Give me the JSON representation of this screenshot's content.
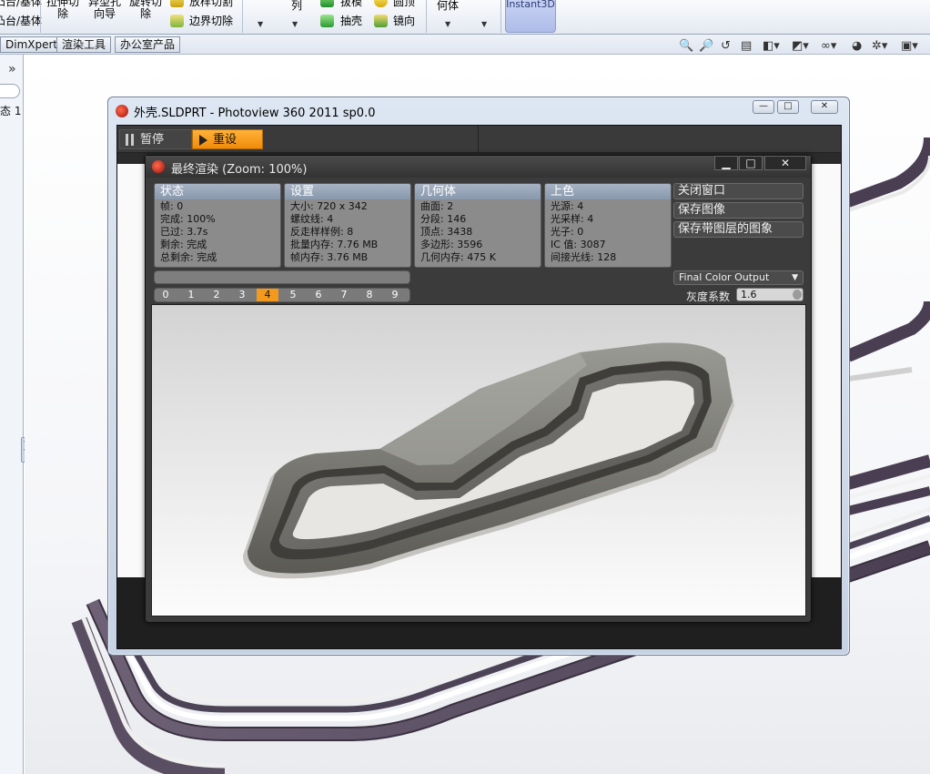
{
  "ribbon": {
    "col1": [
      "凸台/基体",
      "凸台/基体"
    ],
    "extrude_cut": "拉伸切\n除",
    "hole_wizard": "异型孔\n向导",
    "revolve_cut": "旋转切\n除",
    "sweep_cut": "放样切割",
    "boundary_cut": "边界切除",
    "pattern": "列",
    "draft": "拔模",
    "shell": "抽壳",
    "dome": "圆顶",
    "mirror": "镜向",
    "geometry": "何体",
    "instant3d": "Instant3D"
  },
  "tabs": [
    "DimXpert",
    "渲染工具",
    "办公室产品"
  ],
  "left_panel": {
    "chevron": "»",
    "state_text": "态 1"
  },
  "photoview": {
    "title": "外壳.SLDPRT - Photoview 360 2011 sp0.0",
    "pause_label": "暂停",
    "reset_label": "重设"
  },
  "final_render": {
    "title": "最终渲染 (Zoom: 100%)",
    "minimize": "▁",
    "restore": "□",
    "close": "✕",
    "status": {
      "header": "状态",
      "lines": [
        "帧: 0",
        "完成: 100%",
        "已过: 3.7s",
        "剩余: 完成",
        "总剩余: 完成"
      ]
    },
    "settings": {
      "header": "设置",
      "lines": [
        "大小: 720 x 342",
        "螺纹线: 4",
        "反走样样例: 8",
        "批量内存: 7.76 MB",
        "帧内存: 3.76 MB"
      ]
    },
    "geometry": {
      "header": "几何体",
      "lines": [
        "曲面: 2",
        "分段: 146",
        "顶点: 3438",
        "多边形: 3596",
        "几何内存: 475 K"
      ]
    },
    "shading": {
      "header": "上色",
      "lines": [
        "光源: 4",
        "光采样: 4",
        "光子: 0",
        "IC 值: 3087",
        "间接光线: 128"
      ]
    },
    "actions": {
      "close_window": "关闭窗口",
      "save_image": "保存图像",
      "save_layers": "保存带图层的图象"
    },
    "frames": [
      "0",
      "1",
      "2",
      "3",
      "4",
      "5",
      "6",
      "7",
      "8",
      "9"
    ],
    "active_frame": "4",
    "output_select": "Final Color Output",
    "gamma_label": "灰度系数",
    "gamma_value": "1.6",
    "progress": 0
  },
  "colors": {
    "accent_orange": "#f39a1e",
    "header_blue": "#8898ad",
    "dark_panel": "#3b3b3b"
  }
}
